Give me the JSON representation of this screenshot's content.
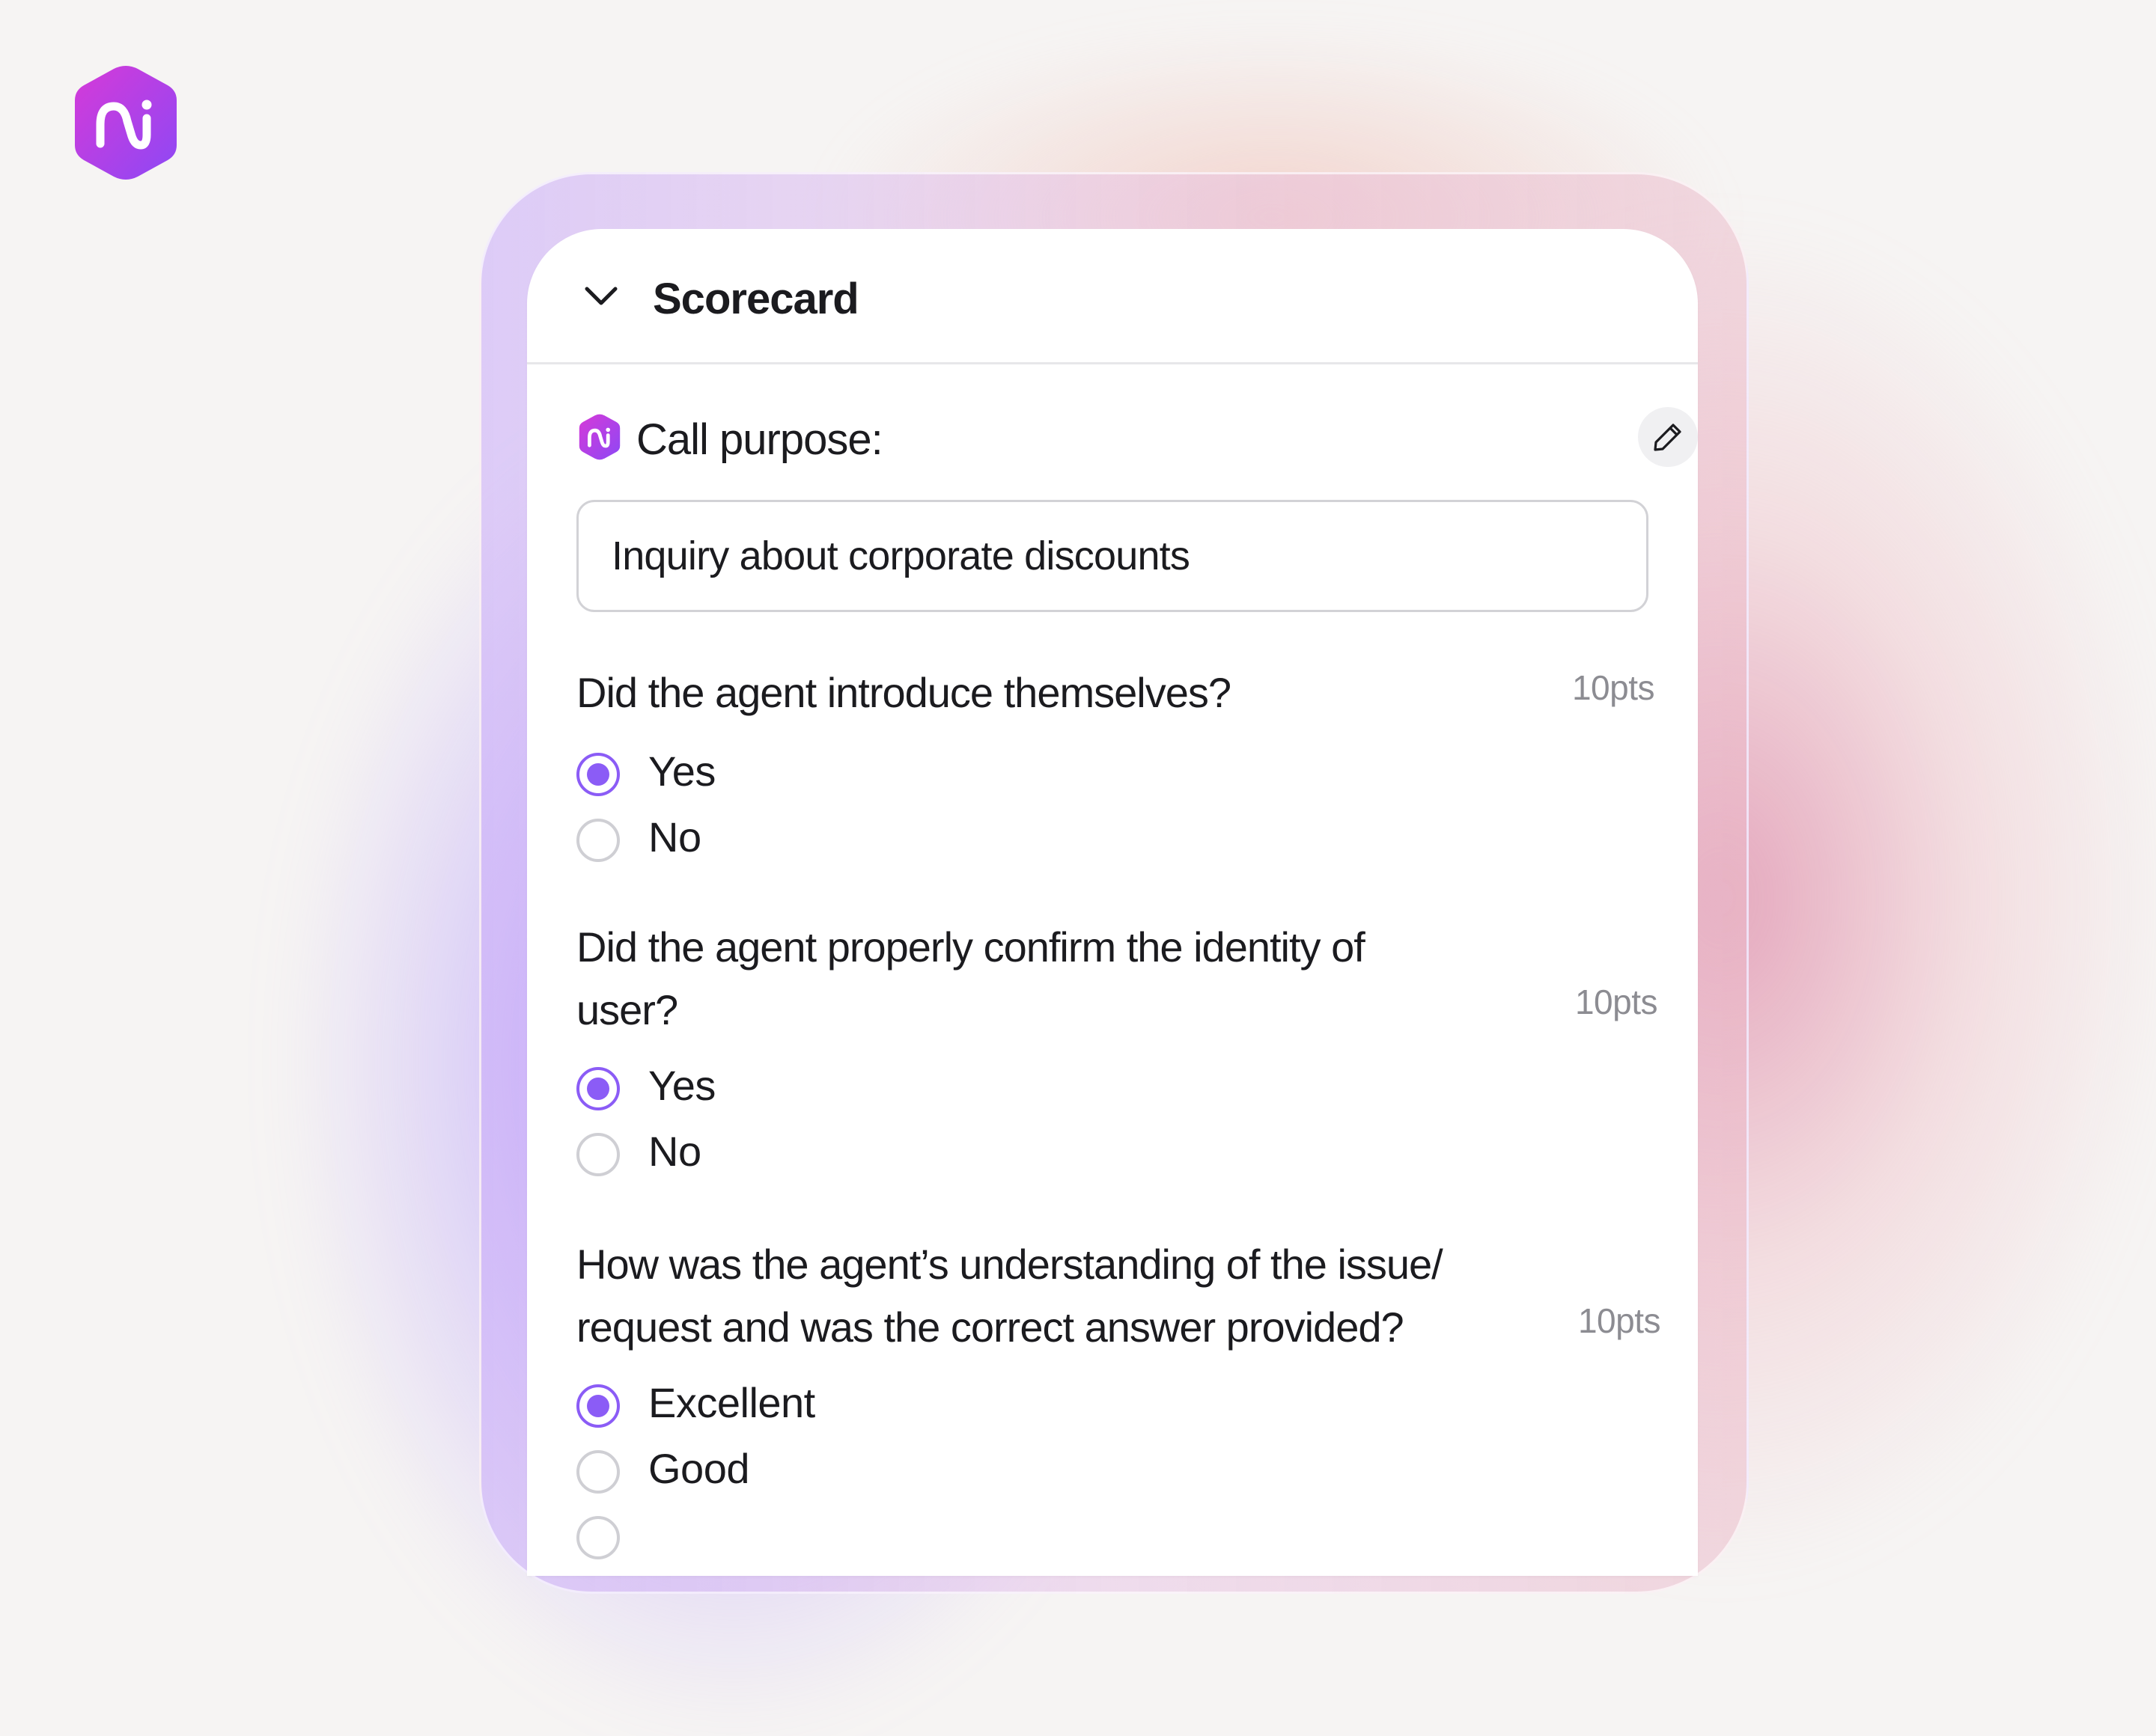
{
  "app": {
    "logo_icon": "ni-hexagon-logo-icon",
    "brand_gradient": [
      "#d63ad8",
      "#8d48f5"
    ]
  },
  "scorecard": {
    "title": "Scorecard",
    "collapse_icon": "chevron-down-icon",
    "call_purpose": {
      "label": "Call purpose:",
      "value": "Inquiry about corporate discounts",
      "edit_icon": "pencil-icon"
    },
    "questions": [
      {
        "text": "Did the agent introduce themselves?",
        "points": "10pts",
        "options": [
          {
            "label": "Yes",
            "checked": true
          },
          {
            "label": "No",
            "checked": false
          }
        ]
      },
      {
        "text": "Did the agent properly confirm the identity of user?",
        "points": "10pts",
        "options": [
          {
            "label": "Yes",
            "checked": true
          },
          {
            "label": "No",
            "checked": false
          }
        ]
      },
      {
        "text": "How was the agent’s understanding of the issue/ request and was the correct answer provided?",
        "points": "10pts",
        "options": [
          {
            "label": "Excellent",
            "checked": true
          },
          {
            "label": "Good",
            "checked": false
          }
        ]
      }
    ]
  },
  "colors": {
    "accent": "#8b5cf6",
    "radio_border": "#cfcfd4",
    "points_text": "#8c8c92"
  }
}
